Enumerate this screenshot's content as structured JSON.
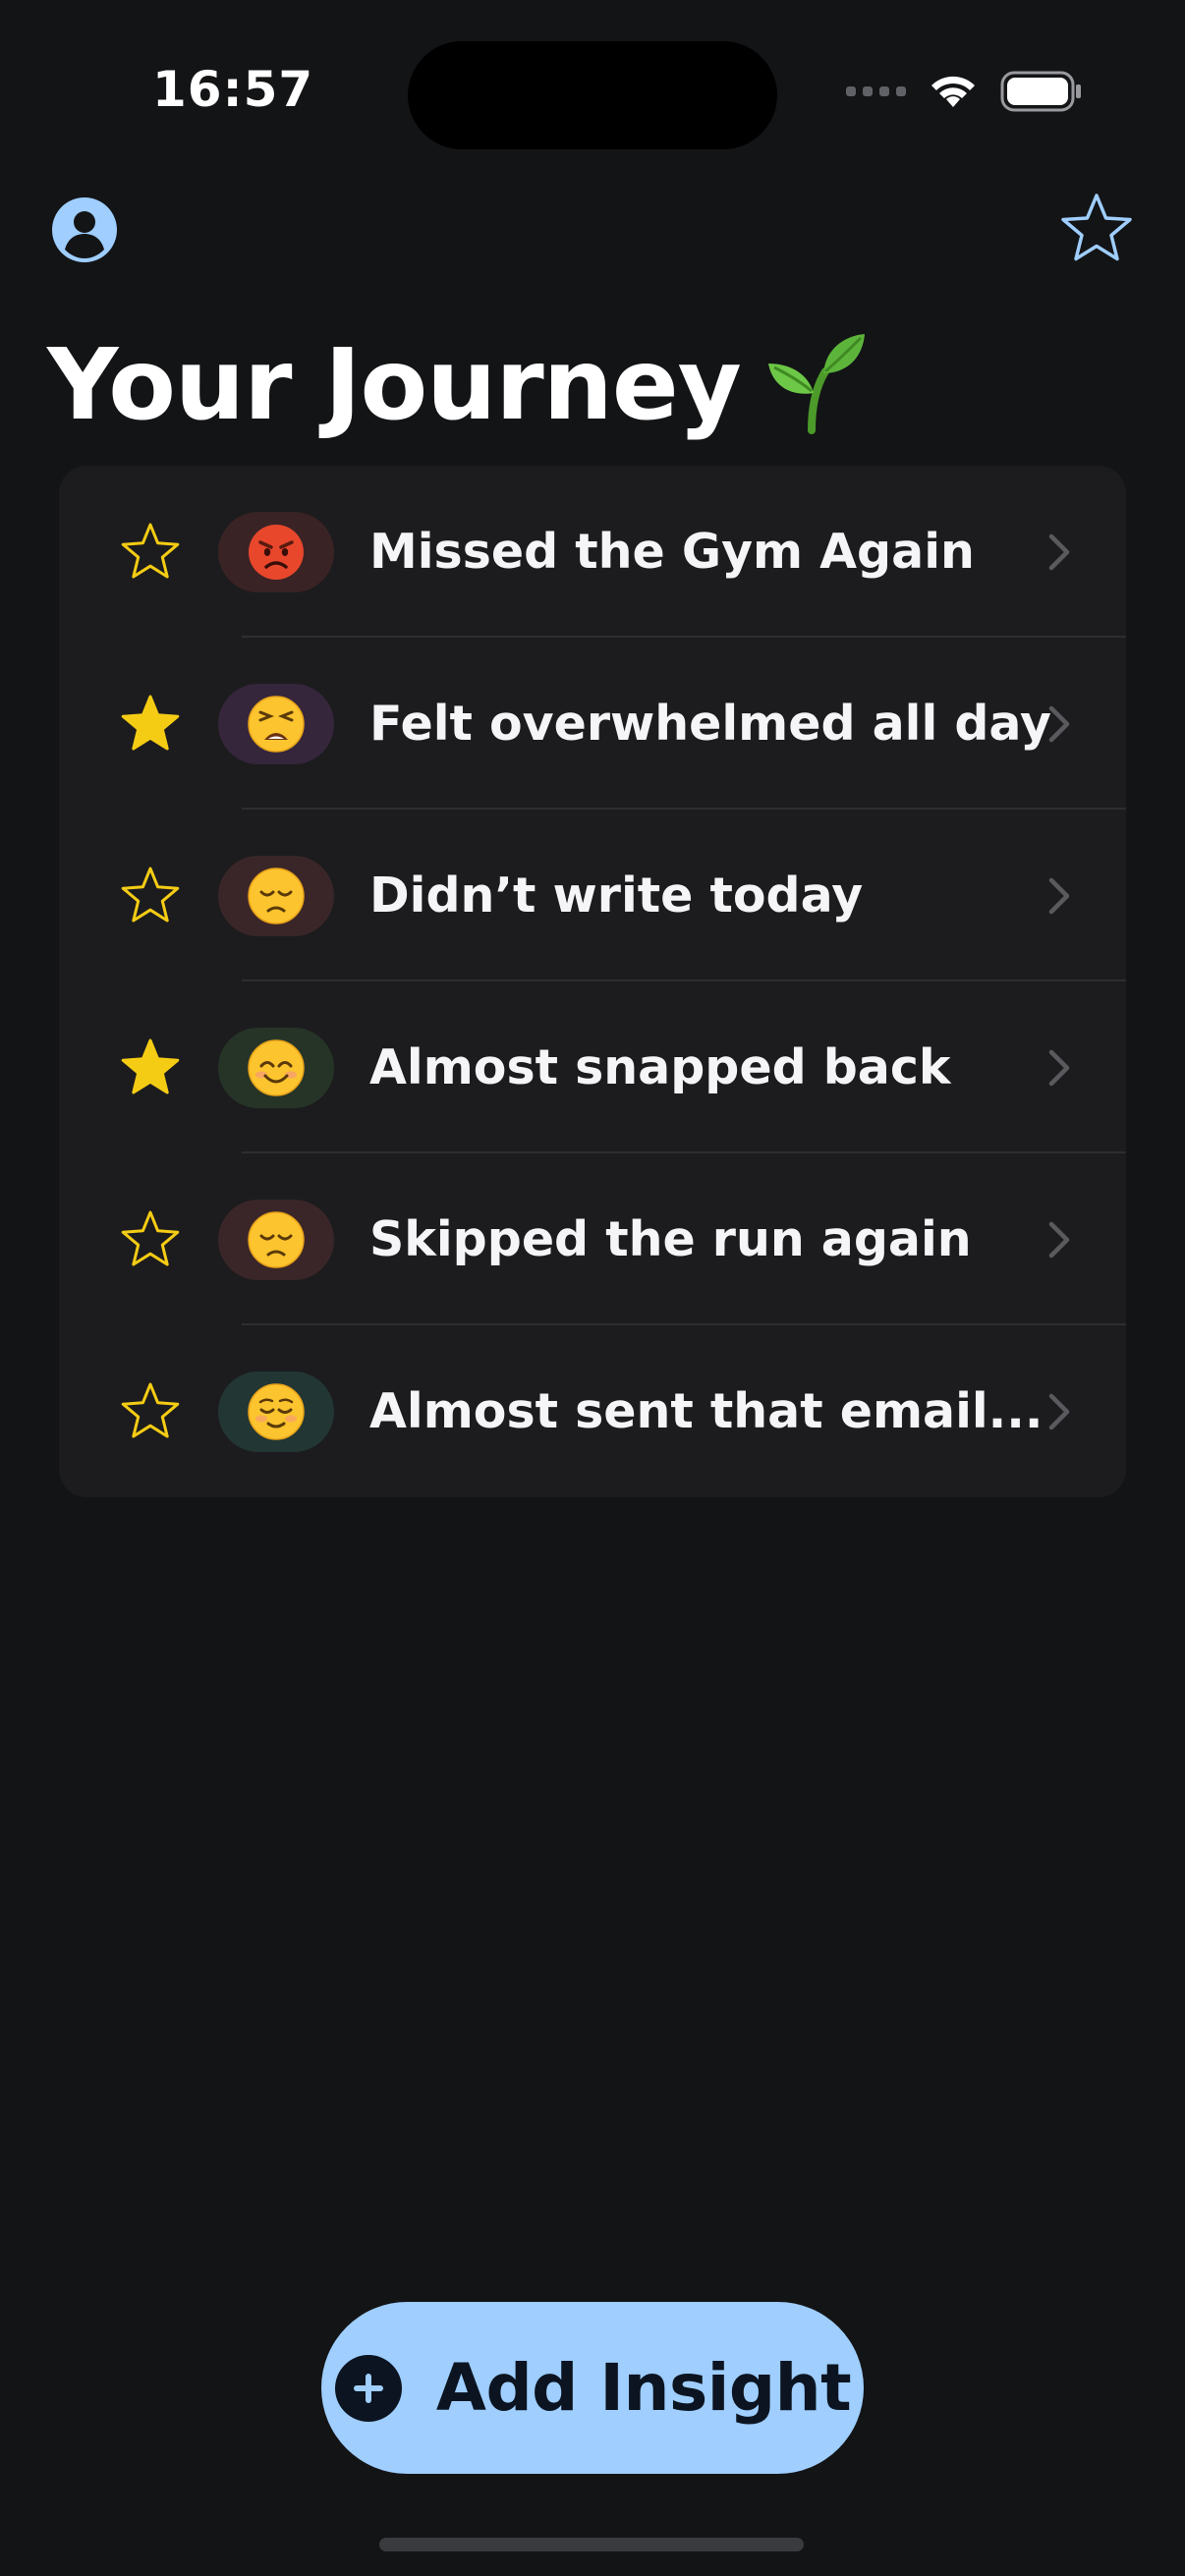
{
  "status_bar": {
    "time": "16:57"
  },
  "nav": {
    "profile_icon": "person-circle-icon",
    "favorites_icon": "star-outline-icon"
  },
  "page_title": "Your Journey",
  "title_emoji": "sprout-emoji",
  "entries": [
    {
      "title": "Missed the Gym Again",
      "starred": false,
      "mood": "angry-face",
      "mood_bg": "#3a2325"
    },
    {
      "title": "Felt overwhelmed all day",
      "starred": true,
      "mood": "weary-face",
      "mood_bg": "#35263c"
    },
    {
      "title": "Didn’t write today",
      "starred": false,
      "mood": "disappointed-face",
      "mood_bg": "#3a2628"
    },
    {
      "title": "Almost snapped back",
      "starred": true,
      "mood": "smiling-face",
      "mood_bg": "#263428"
    },
    {
      "title": "Skipped the run again",
      "starred": false,
      "mood": "disappointed-face",
      "mood_bg": "#3a2628"
    },
    {
      "title": "Almost sent that email...",
      "starred": false,
      "mood": "relieved-face",
      "mood_bg": "#223633"
    }
  ],
  "add_button": {
    "label": "Add Insight",
    "icon": "plus-circle-icon"
  },
  "colors": {
    "background": "#131416",
    "card": "#1c1c1e",
    "accent": "#9fceff",
    "star_yellow": "#f5cc14"
  }
}
